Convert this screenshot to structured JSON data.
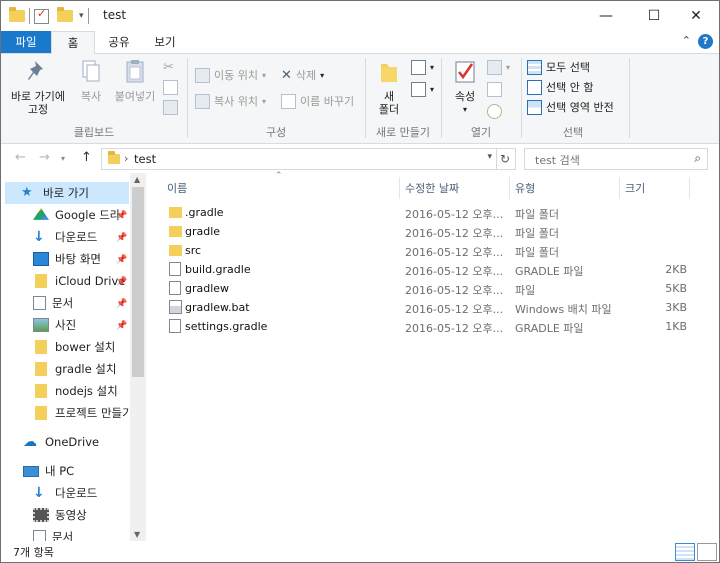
{
  "window": {
    "title": "test",
    "minimize_glyph": "—",
    "maximize_glyph": "☐",
    "close_glyph": "✕"
  },
  "tabs": [
    {
      "label": "파일"
    },
    {
      "label": "홈"
    },
    {
      "label": "공유"
    },
    {
      "label": "보기"
    }
  ],
  "ribbon": {
    "clipboard": {
      "pin_label_line1": "바로 가기에",
      "pin_label_line2": "고정",
      "copy_label": "복사",
      "paste_label": "붙여넣기",
      "group_label": "클립보드"
    },
    "organize": {
      "move_to": "이동 위치",
      "copy_to": "복사 위치",
      "delete": "삭제",
      "rename": "이름 바꾸기",
      "group_label": "구성"
    },
    "new": {
      "new_folder_line1": "새",
      "new_folder_line2": "폴더",
      "group_label": "새로 만들기"
    },
    "open": {
      "properties": "속성",
      "group_label": "열기"
    },
    "select": {
      "select_all": "모두 선택",
      "select_none": "선택 안 함",
      "invert": "선택 영역 반전",
      "group_label": "선택"
    }
  },
  "address": {
    "path": "test",
    "search_placeholder": "test 검색"
  },
  "nav_pane": {
    "items": [
      {
        "label": "바로 가기",
        "icon": "star-icon",
        "pinned": false
      },
      {
        "label": "Google 드라",
        "icon": "google-drive-icon",
        "pinned": true
      },
      {
        "label": "다운로드",
        "icon": "download-icon",
        "pinned": true
      },
      {
        "label": "바탕 화면",
        "icon": "desktop-icon",
        "pinned": true
      },
      {
        "label": "iCloud Drive",
        "icon": "folder-icon",
        "pinned": true
      },
      {
        "label": "문서",
        "icon": "documents-icon",
        "pinned": true
      },
      {
        "label": "사진",
        "icon": "pictures-icon",
        "pinned": true
      },
      {
        "label": "bower 설치",
        "icon": "folder-icon",
        "pinned": false
      },
      {
        "label": "gradle 설치",
        "icon": "folder-icon",
        "pinned": false
      },
      {
        "label": "nodejs 설치",
        "icon": "folder-icon",
        "pinned": false
      },
      {
        "label": "프로젝트 만들기",
        "icon": "folder-icon",
        "pinned": false
      },
      {
        "label": "OneDrive",
        "icon": "onedrive-icon",
        "pinned": false
      },
      {
        "label": "내 PC",
        "icon": "pc-icon",
        "pinned": false
      },
      {
        "label": "다운로드",
        "icon": "download-icon",
        "pinned": false
      },
      {
        "label": "동영상",
        "icon": "video-icon",
        "pinned": false
      },
      {
        "label": "문서",
        "icon": "documents-icon",
        "pinned": false
      }
    ]
  },
  "file_list": {
    "columns": {
      "name": "이름",
      "date": "수정한 날짜",
      "type": "유형",
      "size": "크기"
    },
    "rows": [
      {
        "name": ".gradle",
        "date": "2016-05-12 오후...",
        "type": "파일 폴더",
        "size": "",
        "icon": "folder-icon"
      },
      {
        "name": "gradle",
        "date": "2016-05-12 오후...",
        "type": "파일 폴더",
        "size": "",
        "icon": "folder-icon"
      },
      {
        "name": "src",
        "date": "2016-05-12 오후...",
        "type": "파일 폴더",
        "size": "",
        "icon": "folder-icon"
      },
      {
        "name": "build.gradle",
        "date": "2016-05-12 오후...",
        "type": "GRADLE 파일",
        "size": "2KB",
        "icon": "file-icon"
      },
      {
        "name": "gradlew",
        "date": "2016-05-12 오후...",
        "type": "파일",
        "size": "5KB",
        "icon": "file-icon"
      },
      {
        "name": "gradlew.bat",
        "date": "2016-05-12 오후...",
        "type": "Windows 배치 파일",
        "size": "3KB",
        "icon": "batch-file-icon"
      },
      {
        "name": "settings.gradle",
        "date": "2016-05-12 오후...",
        "type": "GRADLE 파일",
        "size": "1KB",
        "icon": "file-icon"
      }
    ]
  },
  "status": {
    "item_count": "7개 항목"
  },
  "colors": {
    "file_tab": "#1979ca",
    "selection": "#cce8ff",
    "folder": "#f4cf5b"
  }
}
